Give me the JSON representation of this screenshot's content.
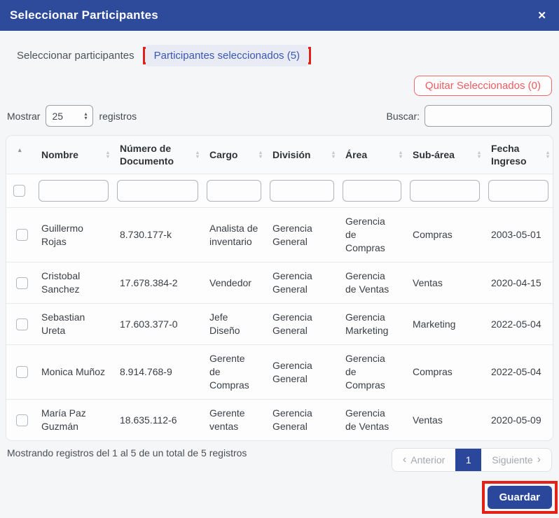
{
  "modal": {
    "title": "Seleccionar Participantes"
  },
  "icons": {
    "close": "✕",
    "sort_asc": "▴",
    "sort_desc": "▾",
    "prev_chevron": "‹",
    "next_chevron": "›"
  },
  "tabs": {
    "inactive": "Seleccionar participantes",
    "active": "Participantes seleccionados (5)"
  },
  "toolbar": {
    "remove_selected": "Quitar Seleccionados (0)",
    "show": "Mostrar",
    "page_size": "25",
    "records": "registros",
    "search": "Buscar:"
  },
  "table": {
    "columns": [
      "Nombre",
      "Número de Documento",
      "Cargo",
      "División",
      "Área",
      "Sub-área",
      "Fecha Ingreso"
    ]
  },
  "rows": [
    {
      "nombre": "Guillermo Rojas",
      "documento": "8.730.177-k",
      "cargo": "Analista de inventario",
      "division": "Gerencia General",
      "area": "Gerencia de Compras",
      "subarea": "Compras",
      "fecha": "2003-05-01"
    },
    {
      "nombre": "Cristobal Sanchez",
      "documento": "17.678.384-2",
      "cargo": "Vendedor",
      "division": "Gerencia General",
      "area": "Gerencia de Ventas",
      "subarea": "Ventas",
      "fecha": "2020-04-15"
    },
    {
      "nombre": "Sebastian Ureta",
      "documento": "17.603.377-0",
      "cargo": "Jefe Diseño",
      "division": "Gerencia General",
      "area": "Gerencia Marketing",
      "subarea": "Marketing",
      "fecha": "2022-05-04"
    },
    {
      "nombre": "Monica Muñoz",
      "documento": "8.914.768-9",
      "cargo": "Gerente de Compras",
      "division": "Gerencia General",
      "area": "Gerencia de Compras",
      "subarea": "Compras",
      "fecha": "2022-05-04"
    },
    {
      "nombre": "María Paz Guzmán",
      "documento": "18.635.112-6",
      "cargo": "Gerente ventas",
      "division": "Gerencia General",
      "area": "Gerencia de Ventas",
      "subarea": "Ventas",
      "fecha": "2020-05-09"
    }
  ],
  "footer": {
    "info": "Mostrando registros del 1 al 5 de un total de 5 registros",
    "prev": "Anterior",
    "page": "1",
    "next": "Siguiente"
  },
  "actions": {
    "save": "Guardar"
  },
  "colors": {
    "header_blue": "#2d4a9b",
    "accent_blue": "#2b479c",
    "active_tab_bg": "#e8ebf4",
    "annotation_red": "#e32119",
    "danger_red": "#ef5b60"
  }
}
